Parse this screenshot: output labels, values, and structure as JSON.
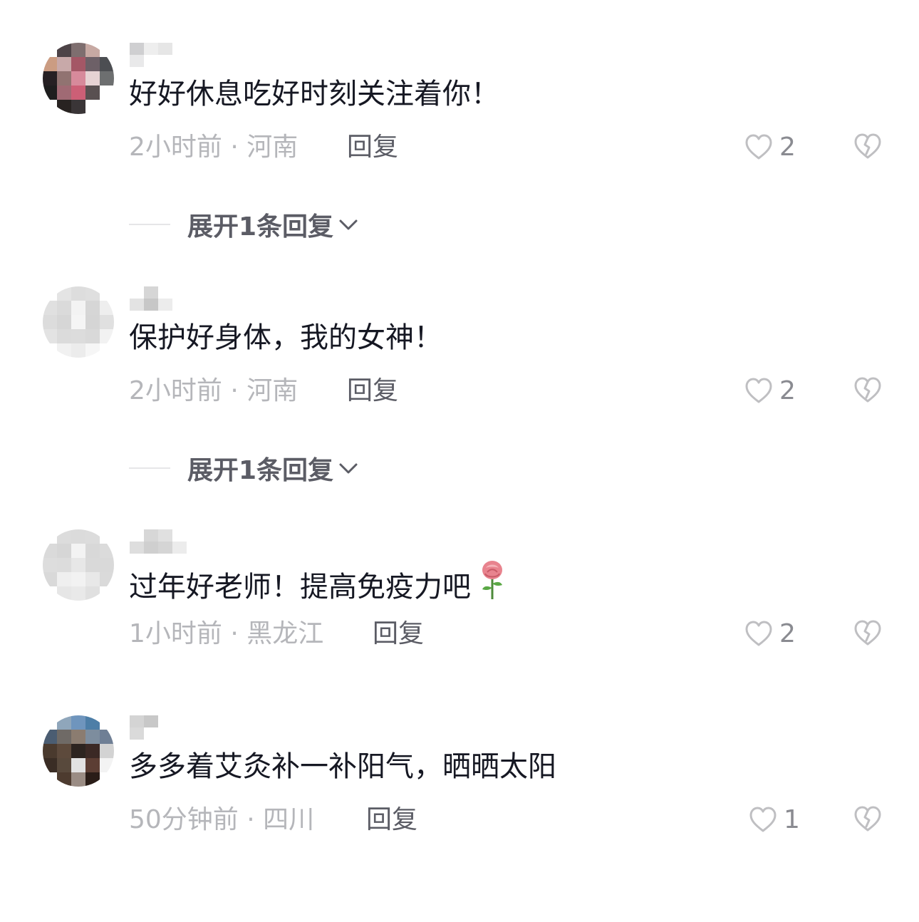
{
  "comments": [
    {
      "text": "好好休息吃好时刻关注着你！",
      "meta": "2小时前 · 河南",
      "reply_label": "回复",
      "likes": "2",
      "expand_label": "展开1条回复",
      "avatar_colors": [
        "#ffffff",
        "#4d4347",
        "#7e6e6f",
        "#c7a9a3",
        "#ffffff",
        "#cb9c82",
        "#c8a9a9",
        "#a45766",
        "#6d6067",
        "#4c4e52",
        "#262023",
        "#917371",
        "#d78a9b",
        "#e6d2d3",
        "#6d6f70",
        "#1e1e1e",
        "#a06a74",
        "#cc5f76",
        "#595051",
        "#ffffff",
        "#ffffff",
        "#282321",
        "#3a3537",
        "#ffffff",
        "#ffffff"
      ],
      "name_colors": [
        "#cfcfd1",
        "#eeeeee",
        "#e6e6e6",
        "#ffffff",
        "#e9e9ea",
        "#ffffff",
        "#ffffff",
        "#ffffff"
      ]
    },
    {
      "text": "保护好身体，我的女神！",
      "meta": "2小时前 · 河南",
      "reply_label": "回复",
      "likes": "2",
      "expand_label": "展开1条回复",
      "avatar_colors": [
        "#ffffff",
        "#e4e4e4",
        "#dddddd",
        "#dfdfdf",
        "#ffffff",
        "#e0e0e0",
        "#dadada",
        "#f3f3f3",
        "#d6d6d6",
        "#eeeeee",
        "#dcdcdc",
        "#d6d6d6",
        "#f5f5f5",
        "#d5d5d5",
        "#e0e0e0",
        "#e3e3e3",
        "#dbdbdb",
        "#dcdcdc",
        "#d9d9d9",
        "#f2f2f2",
        "#ffffff",
        "#f1f1f1",
        "#ececec",
        "#f6f6f6",
        "#ffffff"
      ],
      "name_colors": [
        "#ffffff",
        "#d6d6d6",
        "#ffffff",
        "#ffffff",
        "#e3e3e3",
        "#c7c7c7",
        "#ececec",
        "#ffffff"
      ]
    },
    {
      "text": "过年好老师！提高免疫力吧",
      "meta": "1小时前 · 黑龙江",
      "reply_label": "回复",
      "likes": "2",
      "expand_label": "",
      "avatar_colors": [
        "#ffffff",
        "#dcdcdc",
        "#dbdbdb",
        "#dcdcdc",
        "#ffffff",
        "#dadada",
        "#d6d6d6",
        "#f3f3f3",
        "#d8d8d8",
        "#dbdbdb",
        "#dddddd",
        "#dcdcdc",
        "#e7e7e7",
        "#d9d9d9",
        "#d9d9d9",
        "#d9d9d9",
        "#efefef",
        "#f2f2f2",
        "#e8e8e8",
        "#dadada",
        "#ffffff",
        "#e6e6e6",
        "#e9e9e9",
        "#e0e0e0",
        "#ffffff"
      ],
      "name_colors": [
        "#ffffff",
        "#d7d7d7",
        "#e0e0e0",
        "#ffffff",
        "#dedede",
        "#cfcfcf",
        "#d5d5d5",
        "#ececec"
      ]
    },
    {
      "text": "多多着艾灸补一补阳气，晒晒太阳",
      "meta": "50分钟前 · 四川",
      "reply_label": "回复",
      "likes": "1",
      "expand_label": "",
      "avatar_colors": [
        "#ffffff",
        "#8fa6bb",
        "#6f95bd",
        "#4d7ea7",
        "#ffffff",
        "#4b5d72",
        "#6f6a66",
        "#8b7c70",
        "#7d8d9e",
        "#6f7f95",
        "#4a3a2e",
        "#5d4a3c",
        "#2d2420",
        "#3b2925",
        "#d3d3d3",
        "#3a2d25",
        "#58493c",
        "#e2e2e2",
        "#5c3e34",
        "#f3f3f3",
        "#ffffff",
        "#4d3b2f",
        "#9a8c84",
        "#2a1d18",
        "#ffffff"
      ],
      "name_colors": [
        "#d4d4d4",
        "#c8c8c8",
        "#ffffff",
        "#ffffff",
        "#dadada",
        "#ffffff",
        "#ffffff",
        "#ffffff"
      ]
    }
  ],
  "theme": {
    "text_color": "#161823",
    "meta_color": "#b5b6ba",
    "reply_color": "#5b5c65",
    "icon_color": "#bfbfc2"
  }
}
